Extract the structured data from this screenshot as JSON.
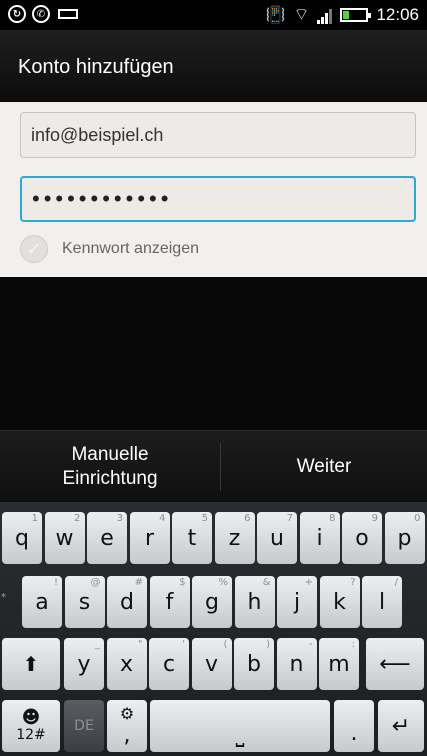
{
  "status_bar": {
    "left_icons": [
      "sync-icon",
      "whatsapp-icon",
      "keyboard-icon"
    ],
    "right_icons": [
      "vibrate-icon",
      "wifi-icon",
      "signal-icon",
      "battery-icon"
    ],
    "time": "12:06"
  },
  "title_bar": {
    "title": "Konto hinzufügen"
  },
  "form": {
    "email_value": "info@beispiel.ch",
    "password_value": "••••••••••••",
    "show_password_label": "Kennwort anzeigen",
    "show_password_checked": false
  },
  "actions": {
    "manual_setup_label": "Manuelle Einrichtung",
    "next_label": "Weiter"
  },
  "keyboard": {
    "row1": [
      {
        "label": "q",
        "hint": "1"
      },
      {
        "label": "w",
        "hint": "2"
      },
      {
        "label": "e",
        "hint": "3"
      },
      {
        "label": "r",
        "hint": "4"
      },
      {
        "label": "t",
        "hint": "5"
      },
      {
        "label": "z",
        "hint": "6"
      },
      {
        "label": "u",
        "hint": "7"
      },
      {
        "label": "i",
        "hint": "8"
      },
      {
        "label": "o",
        "hint": "9"
      },
      {
        "label": "p",
        "hint": "0"
      }
    ],
    "row2": [
      {
        "label": "a",
        "hint": "!"
      },
      {
        "label": "s",
        "hint": "@"
      },
      {
        "label": "d",
        "hint": "#"
      },
      {
        "label": "f",
        "hint": "$"
      },
      {
        "label": "g",
        "hint": "%"
      },
      {
        "label": "h",
        "hint": "&"
      },
      {
        "label": "j",
        "hint": "+"
      },
      {
        "label": "k",
        "hint": "?"
      },
      {
        "label": "l",
        "hint": "/"
      }
    ],
    "row3": [
      {
        "label": "y",
        "hint": "_"
      },
      {
        "label": "x",
        "hint": "\""
      },
      {
        "label": "c",
        "hint": "'"
      },
      {
        "label": "v",
        "hint": "("
      },
      {
        "label": "b",
        "hint": ")"
      },
      {
        "label": "n",
        "hint": "-"
      },
      {
        "label": "m",
        "hint": ":"
      }
    ],
    "symbols_label": "12#",
    "language_label": "DE",
    "comma_label": ",",
    "period_label": ".",
    "left_hint": "*"
  },
  "colors": {
    "accent": "#2aa8d8",
    "form_bg": "#f2efed",
    "battery": "#5fd12f"
  }
}
